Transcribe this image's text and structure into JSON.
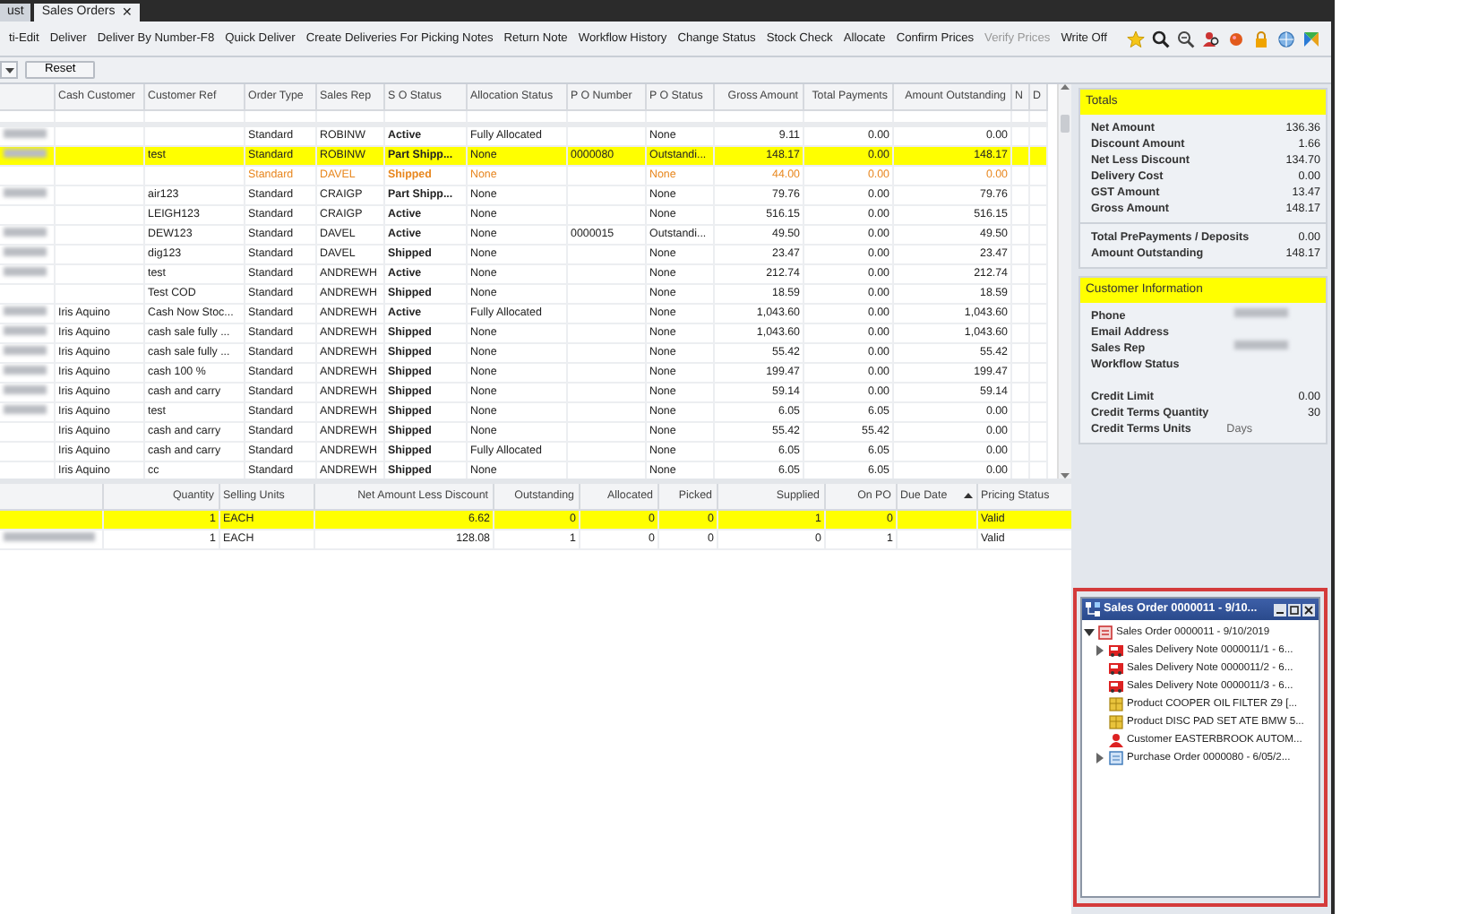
{
  "tabs": [
    {
      "label": "ust",
      "selected": false
    },
    {
      "label": "Sales Orders",
      "selected": true,
      "close": "✕"
    }
  ],
  "toolbar": {
    "commands": [
      {
        "label": "ti-Edit",
        "disabled": false
      },
      {
        "label": "Deliver",
        "disabled": false
      },
      {
        "label": "Deliver By Number-F8",
        "disabled": false
      },
      {
        "label": "Quick Deliver",
        "disabled": false
      },
      {
        "label": "Create Deliveries For Picking Notes",
        "disabled": false
      },
      {
        "label": "Return Note",
        "disabled": false
      },
      {
        "label": "Workflow History",
        "disabled": false
      },
      {
        "label": "Change Status",
        "disabled": false
      },
      {
        "label": "Stock Check",
        "disabled": false
      },
      {
        "label": "Allocate",
        "disabled": false
      },
      {
        "label": "Confirm Prices",
        "disabled": false
      },
      {
        "label": "Verify Prices",
        "disabled": true
      },
      {
        "label": "Write Off",
        "disabled": false
      }
    ]
  },
  "filter_bar": {
    "reset_button": "Reset"
  },
  "orders_table": {
    "columns": [
      "Cash Customer",
      "Customer Ref",
      "Order Type",
      "Sales Rep",
      "S O Status",
      "Allocation Status",
      "P O Number",
      "P O Status",
      "Gross Amount",
      "Total Payments",
      "Amount Outstanding",
      "N",
      "D"
    ],
    "rows": [
      {
        "redacted": true,
        "selected": false,
        "flagged": false,
        "order_type": "Standard",
        "sales_rep": "ROBINW",
        "so_status": "Active",
        "allocation_status": "Fully Allocated",
        "po_status": "None",
        "gross_amount": "9.11",
        "total_payments": "0.00",
        "amount_outstanding": "0.00"
      },
      {
        "redacted": true,
        "selected": true,
        "flagged": false,
        "customer_ref": "test",
        "order_type": "Standard",
        "sales_rep": "ROBINW",
        "so_status": "Part Shipp...",
        "allocation_status": "None",
        "po_number": "0000080",
        "po_status": "Outstandi...",
        "gross_amount": "148.17",
        "total_payments": "0.00",
        "amount_outstanding": "148.17"
      },
      {
        "redacted": false,
        "selected": false,
        "flagged": true,
        "order_type": "Standard",
        "sales_rep": "DAVEL",
        "so_status": "Shipped",
        "allocation_status": "None",
        "po_status": "None",
        "gross_amount": "44.00",
        "total_payments": "0.00",
        "amount_outstanding": "0.00"
      },
      {
        "redacted": true,
        "selected": false,
        "flagged": false,
        "customer_ref": "air123",
        "order_type": "Standard",
        "sales_rep": "CRAIGP",
        "so_status": "Part Shipp...",
        "allocation_status": "None",
        "po_status": "None",
        "gross_amount": "79.76",
        "total_payments": "0.00",
        "amount_outstanding": "79.76"
      },
      {
        "redacted": false,
        "selected": false,
        "flagged": false,
        "customer_ref": "LEIGH123",
        "order_type": "Standard",
        "sales_rep": "CRAIGP",
        "so_status": "Active",
        "allocation_status": "None",
        "po_status": "None",
        "gross_amount": "516.15",
        "total_payments": "0.00",
        "amount_outstanding": "516.15"
      },
      {
        "redacted": true,
        "selected": false,
        "flagged": false,
        "customer_ref": "DEW123",
        "order_type": "Standard",
        "sales_rep": "DAVEL",
        "so_status": "Active",
        "allocation_status": "None",
        "po_number": "0000015",
        "po_status": "Outstandi...",
        "gross_amount": "49.50",
        "total_payments": "0.00",
        "amount_outstanding": "49.50"
      },
      {
        "redacted": true,
        "selected": false,
        "flagged": false,
        "customer_ref": "dig123",
        "order_type": "Standard",
        "sales_rep": "DAVEL",
        "so_status": "Shipped",
        "allocation_status": "None",
        "po_status": "None",
        "gross_amount": "23.47",
        "total_payments": "0.00",
        "amount_outstanding": "23.47"
      },
      {
        "redacted": true,
        "selected": false,
        "flagged": false,
        "customer_ref": "test",
        "order_type": "Standard",
        "sales_rep": "ANDREWH",
        "so_status": "Active",
        "allocation_status": "None",
        "po_status": "None",
        "gross_amount": "212.74",
        "total_payments": "0.00",
        "amount_outstanding": "212.74"
      },
      {
        "redacted": false,
        "selected": false,
        "flagged": false,
        "customer_ref": "Test COD",
        "order_type": "Standard",
        "sales_rep": "ANDREWH",
        "so_status": "Shipped",
        "allocation_status": "None",
        "po_status": "None",
        "gross_amount": "18.59",
        "total_payments": "0.00",
        "amount_outstanding": "18.59"
      },
      {
        "redacted": true,
        "selected": false,
        "flagged": false,
        "cash_customer": "Iris Aquino",
        "customer_ref": "Cash Now Stoc...",
        "order_type": "Standard",
        "sales_rep": "ANDREWH",
        "so_status": "Active",
        "allocation_status": "Fully Allocated",
        "po_status": "None",
        "gross_amount": "1,043.60",
        "total_payments": "0.00",
        "amount_outstanding": "1,043.60"
      },
      {
        "redacted": true,
        "selected": false,
        "flagged": false,
        "cash_customer": "Iris Aquino",
        "customer_ref": "cash sale fully ...",
        "order_type": "Standard",
        "sales_rep": "ANDREWH",
        "so_status": "Shipped",
        "allocation_status": "None",
        "po_status": "None",
        "gross_amount": "1,043.60",
        "total_payments": "0.00",
        "amount_outstanding": "1,043.60"
      },
      {
        "redacted": true,
        "selected": false,
        "flagged": false,
        "cash_customer": "Iris Aquino",
        "customer_ref": "cash sale fully ...",
        "order_type": "Standard",
        "sales_rep": "ANDREWH",
        "so_status": "Shipped",
        "allocation_status": "None",
        "po_status": "None",
        "gross_amount": "55.42",
        "total_payments": "0.00",
        "amount_outstanding": "55.42"
      },
      {
        "redacted": true,
        "selected": false,
        "flagged": false,
        "cash_customer": "Iris Aquino",
        "customer_ref": "cash 100 %",
        "order_type": "Standard",
        "sales_rep": "ANDREWH",
        "so_status": "Shipped",
        "allocation_status": "None",
        "po_status": "None",
        "gross_amount": "199.47",
        "total_payments": "0.00",
        "amount_outstanding": "199.47"
      },
      {
        "redacted": true,
        "selected": false,
        "flagged": false,
        "cash_customer": "Iris Aquino",
        "customer_ref": "cash and carry",
        "order_type": "Standard",
        "sales_rep": "ANDREWH",
        "so_status": "Shipped",
        "allocation_status": "None",
        "po_status": "None",
        "gross_amount": "59.14",
        "total_payments": "0.00",
        "amount_outstanding": "59.14"
      },
      {
        "redacted": true,
        "selected": false,
        "flagged": false,
        "cash_customer": "Iris Aquino",
        "customer_ref": "test",
        "order_type": "Standard",
        "sales_rep": "ANDREWH",
        "so_status": "Shipped",
        "allocation_status": "None",
        "po_status": "None",
        "gross_amount": "6.05",
        "total_payments": "6.05",
        "amount_outstanding": "0.00"
      },
      {
        "redacted": false,
        "selected": false,
        "flagged": false,
        "cash_customer": "Iris Aquino",
        "customer_ref": "cash and carry",
        "order_type": "Standard",
        "sales_rep": "ANDREWH",
        "so_status": "Shipped",
        "allocation_status": "None",
        "po_status": "None",
        "gross_amount": "55.42",
        "total_payments": "55.42",
        "amount_outstanding": "0.00"
      },
      {
        "redacted": false,
        "selected": false,
        "flagged": false,
        "cash_customer": "Iris Aquino",
        "customer_ref": "cash and carry",
        "order_type": "Standard",
        "sales_rep": "ANDREWH",
        "so_status": "Shipped",
        "allocation_status": "Fully Allocated",
        "po_status": "None",
        "gross_amount": "6.05",
        "total_payments": "6.05",
        "amount_outstanding": "0.00"
      },
      {
        "redacted": false,
        "selected": false,
        "flagged": false,
        "cash_customer": "Iris Aquino",
        "customer_ref": "cc",
        "order_type": "Standard",
        "sales_rep": "ANDREWH",
        "so_status": "Shipped",
        "allocation_status": "None",
        "po_status": "None",
        "gross_amount": "6.05",
        "total_payments": "6.05",
        "amount_outstanding": "0.00"
      }
    ]
  },
  "lines_table": {
    "columns": [
      {
        "label": "Quantity",
        "sorted": false
      },
      {
        "label": "Selling Units",
        "sorted": false
      },
      {
        "label": "Net Amount Less Discount",
        "sorted": false
      },
      {
        "label": "Outstanding",
        "sorted": false
      },
      {
        "label": "Allocated",
        "sorted": false
      },
      {
        "label": "Picked",
        "sorted": false
      },
      {
        "label": "Supplied",
        "sorted": false
      },
      {
        "label": "On PO",
        "sorted": false
      },
      {
        "label": "Due Date",
        "sorted": true
      },
      {
        "label": "Pricing Status",
        "sorted": false
      }
    ],
    "rows": [
      {
        "redacted": false,
        "selected": true,
        "quantity": "1",
        "selling_units": "EACH",
        "net_amount": "6.62",
        "outstanding": "0",
        "allocated": "0",
        "picked": "0",
        "supplied": "1",
        "on_po": "0",
        "pricing_status": "Valid"
      },
      {
        "redacted": true,
        "selected": false,
        "quantity": "1",
        "selling_units": "EACH",
        "net_amount": "128.08",
        "outstanding": "1",
        "allocated": "0",
        "picked": "0",
        "supplied": "0",
        "on_po": "1",
        "pricing_status": "Valid"
      }
    ]
  },
  "totals": {
    "title": "Totals",
    "groups": [
      [
        {
          "label": "Net Amount",
          "kind": "amount",
          "value": "136.36"
        },
        {
          "label": "Discount Amount",
          "kind": "amount",
          "value": "1.66"
        },
        {
          "label": "Net Less Discount",
          "kind": "amount",
          "value": "134.70"
        },
        {
          "label": "Delivery Cost",
          "kind": "amount",
          "value": "0.00"
        },
        {
          "label": "GST Amount",
          "kind": "amount",
          "value": "13.47"
        },
        {
          "label": "Gross Amount",
          "kind": "amount",
          "value": "148.17"
        }
      ],
      [
        {
          "label": "Total PrePayments /  Deposits",
          "kind": "amount",
          "value": "0.00"
        },
        {
          "label": "Amount Outstanding",
          "kind": "amount",
          "value": "148.17"
        }
      ]
    ]
  },
  "customer_information": {
    "title": "Customer Information",
    "groups": [
      [
        {
          "label": "Phone",
          "kind": "redacted"
        },
        {
          "label": "Email Address",
          "kind": "empty"
        },
        {
          "label": "Sales Rep",
          "kind": "redacted"
        },
        {
          "label": "Workflow Status",
          "kind": "empty"
        }
      ],
      [
        {
          "label": "Credit Limit",
          "kind": "amount",
          "value": "0.00"
        },
        {
          "label": "Credit Terms Quantity",
          "kind": "amount",
          "value": "30"
        },
        {
          "label": "Credit Terms Units",
          "kind": "text",
          "value": "Days"
        }
      ]
    ]
  },
  "related_items": {
    "title": "Sales Order 0000011 - 9/10...",
    "nodes": [
      {
        "label": "Sales Order 0000011 - 9/10/2019",
        "kind": "sales-order",
        "expandable": true,
        "expanded": true,
        "children": [
          {
            "label": "Sales Delivery Note 0000011/1 - 6...",
            "kind": "delivery-note",
            "expandable": true,
            "expanded": false
          },
          {
            "label": "Sales Delivery Note 0000011/2 - 6...",
            "kind": "delivery-note"
          },
          {
            "label": "Sales Delivery Note 0000011/3 - 6...",
            "kind": "delivery-note"
          },
          {
            "label": "Product COOPER OIL FILTER Z9 [...",
            "kind": "product"
          },
          {
            "label": "Product DISC PAD SET ATE BMW 5...",
            "kind": "product"
          },
          {
            "label": "Customer EASTERBROOK AUTOM...",
            "kind": "customer"
          },
          {
            "label": "Purchase Order 0000080 - 6/05/2...",
            "kind": "purchase-order",
            "expandable": true,
            "expanded": false
          }
        ]
      }
    ]
  }
}
